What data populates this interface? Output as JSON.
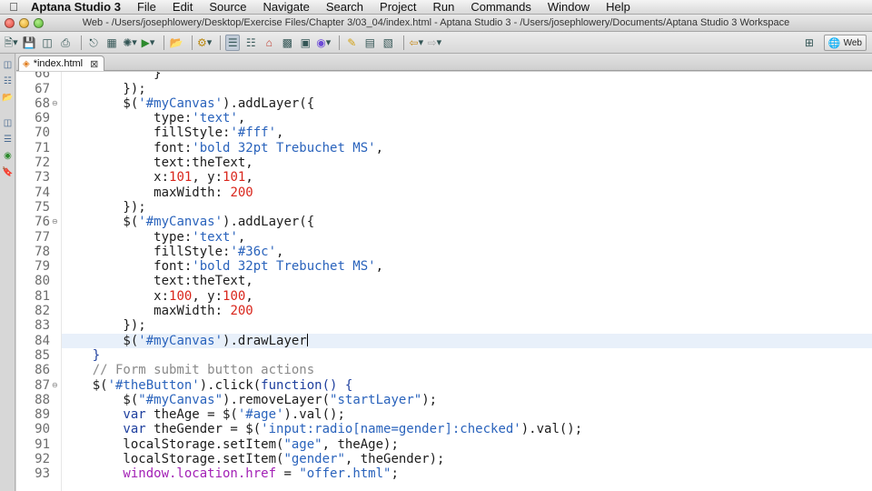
{
  "menubar": {
    "app_name": "Aptana Studio 3",
    "items": [
      "File",
      "Edit",
      "Source",
      "Navigate",
      "Search",
      "Project",
      "Run",
      "Commands",
      "Window",
      "Help"
    ]
  },
  "window": {
    "title": "Web - /Users/josephlowery/Desktop/Exercise Files/Chapter 3/03_04/index.html - Aptana Studio 3 - /Users/josephlowery/Documents/Aptana Studio 3 Workspace"
  },
  "toolbar": {
    "perspective_label": "Web"
  },
  "editor": {
    "tab_label": "*index.html",
    "top_partial_line": {
      "number": "66",
      "text": "            }"
    },
    "lines": [
      {
        "n": "67",
        "fold": false,
        "tokens": [
          [
            "plain",
            "        });"
          ]
        ]
      },
      {
        "n": "68",
        "fold": true,
        "tokens": [
          [
            "plain",
            "        $("
          ],
          [
            "str",
            "'#myCanvas'"
          ],
          [
            "plain",
            ").addLayer({"
          ]
        ]
      },
      {
        "n": "69",
        "fold": false,
        "tokens": [
          [
            "plain",
            "            type:"
          ],
          [
            "str",
            "'text'"
          ],
          [
            "plain",
            ","
          ]
        ]
      },
      {
        "n": "70",
        "fold": false,
        "tokens": [
          [
            "plain",
            "            fillStyle:"
          ],
          [
            "str",
            "'#fff'"
          ],
          [
            "plain",
            ","
          ]
        ]
      },
      {
        "n": "71",
        "fold": false,
        "tokens": [
          [
            "plain",
            "            font:"
          ],
          [
            "str",
            "'bold 32pt Trebuchet MS'"
          ],
          [
            "plain",
            ","
          ]
        ]
      },
      {
        "n": "72",
        "fold": false,
        "tokens": [
          [
            "plain",
            "            text:theText,"
          ]
        ]
      },
      {
        "n": "73",
        "fold": false,
        "tokens": [
          [
            "plain",
            "            x:"
          ],
          [
            "num",
            "101"
          ],
          [
            "plain",
            ", y:"
          ],
          [
            "num",
            "101"
          ],
          [
            "plain",
            ","
          ]
        ]
      },
      {
        "n": "74",
        "fold": false,
        "tokens": [
          [
            "plain",
            "            maxWidth: "
          ],
          [
            "num",
            "200"
          ]
        ]
      },
      {
        "n": "75",
        "fold": false,
        "tokens": [
          [
            "plain",
            "        });"
          ]
        ]
      },
      {
        "n": "76",
        "fold": true,
        "tokens": [
          [
            "plain",
            "        $("
          ],
          [
            "str",
            "'#myCanvas'"
          ],
          [
            "plain",
            ").addLayer({"
          ]
        ]
      },
      {
        "n": "77",
        "fold": false,
        "tokens": [
          [
            "plain",
            "            type:"
          ],
          [
            "str",
            "'text'"
          ],
          [
            "plain",
            ","
          ]
        ]
      },
      {
        "n": "78",
        "fold": false,
        "tokens": [
          [
            "plain",
            "            fillStyle:"
          ],
          [
            "str",
            "'#36c'"
          ],
          [
            "plain",
            ","
          ]
        ]
      },
      {
        "n": "79",
        "fold": false,
        "tokens": [
          [
            "plain",
            "            font:"
          ],
          [
            "str",
            "'bold 32pt Trebuchet MS'"
          ],
          [
            "plain",
            ","
          ]
        ]
      },
      {
        "n": "80",
        "fold": false,
        "tokens": [
          [
            "plain",
            "            text:theText,"
          ]
        ]
      },
      {
        "n": "81",
        "fold": false,
        "tokens": [
          [
            "plain",
            "            x:"
          ],
          [
            "num",
            "100"
          ],
          [
            "plain",
            ", y:"
          ],
          [
            "num",
            "100"
          ],
          [
            "plain",
            ","
          ]
        ]
      },
      {
        "n": "82",
        "fold": false,
        "tokens": [
          [
            "plain",
            "            maxWidth: "
          ],
          [
            "num",
            "200"
          ]
        ]
      },
      {
        "n": "83",
        "fold": false,
        "tokens": [
          [
            "plain",
            "        });"
          ]
        ]
      },
      {
        "n": "84",
        "fold": false,
        "current": true,
        "tokens": [
          [
            "plain",
            "        $("
          ],
          [
            "str",
            "'#myCanvas'"
          ],
          [
            "plain",
            ").drawLayer"
          ]
        ]
      },
      {
        "n": "85",
        "fold": false,
        "tokens": [
          [
            "kw",
            "    }"
          ]
        ]
      },
      {
        "n": "86",
        "fold": false,
        "tokens": [
          [
            "cmt",
            "    // Form submit button actions"
          ]
        ]
      },
      {
        "n": "87",
        "fold": true,
        "tokens": [
          [
            "plain",
            "    $("
          ],
          [
            "str",
            "'#theButton'"
          ],
          [
            "plain",
            ").click("
          ],
          [
            "kw",
            "function() {"
          ]
        ]
      },
      {
        "n": "88",
        "fold": false,
        "tokens": [
          [
            "plain",
            "        $("
          ],
          [
            "str",
            "\"#myCanvas\""
          ],
          [
            "plain",
            ").removeLayer("
          ],
          [
            "str",
            "\"startLayer\""
          ],
          [
            "plain",
            ");"
          ]
        ]
      },
      {
        "n": "89",
        "fold": false,
        "tokens": [
          [
            "kw",
            "        var"
          ],
          [
            "plain",
            " theAge = $("
          ],
          [
            "str",
            "'#age'"
          ],
          [
            "plain",
            ").val();"
          ]
        ]
      },
      {
        "n": "90",
        "fold": false,
        "tokens": [
          [
            "kw",
            "        var"
          ],
          [
            "plain",
            " theGender = $("
          ],
          [
            "str",
            "'input:radio[name=gender]:checked'"
          ],
          [
            "plain",
            ").val();"
          ]
        ]
      },
      {
        "n": "91",
        "fold": false,
        "tokens": [
          [
            "plain",
            "        localStorage.setItem("
          ],
          [
            "str",
            "\"age\""
          ],
          [
            "plain",
            ", theAge);"
          ]
        ]
      },
      {
        "n": "92",
        "fold": false,
        "tokens": [
          [
            "plain",
            "        localStorage.setItem("
          ],
          [
            "str",
            "\"gender\""
          ],
          [
            "plain",
            ", theGender);"
          ]
        ]
      },
      {
        "n": "93",
        "fold": false,
        "tokens": [
          [
            "wind",
            "        window.location.href"
          ],
          [
            "plain",
            " = "
          ],
          [
            "str",
            "\"offer.html\""
          ],
          [
            "plain",
            ";"
          ]
        ]
      }
    ]
  },
  "colors": {
    "string": "#2a63bc",
    "number": "#d9261c",
    "comment": "#8a8a8a",
    "keyword": "#1e3f9e",
    "window_object": "#a321b6",
    "current_line": "#e8f0fa"
  }
}
